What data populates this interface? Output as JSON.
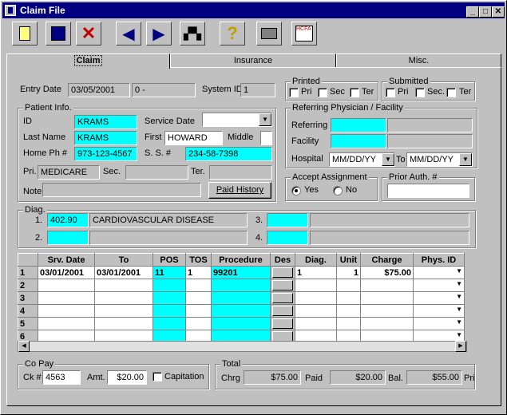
{
  "window": {
    "title": "Claim File"
  },
  "tabs": [
    "Claim",
    "Insurance",
    "Misc."
  ],
  "header": {
    "entry_date_label": "Entry Date",
    "entry_date": "03/05/2001",
    "entry_suffix": "0 -",
    "system_id_label": "System ID",
    "system_id": "1"
  },
  "printed": {
    "title": "Printed",
    "pri": "Pri",
    "sec": "Sec",
    "ter": "Ter"
  },
  "submitted": {
    "title": "Submitted",
    "pri": "Pri",
    "sec": "Sec.",
    "ter": "Ter"
  },
  "patient": {
    "title": "Patient Info.",
    "id_label": "ID",
    "id": "KRAMS",
    "last_label": "Last Name",
    "last": "KRAMS",
    "home_label": "Home Ph #",
    "home": "973-123-4567",
    "service_date_label": "Service Date",
    "service_date": "",
    "first_label": "First",
    "first": "HOWARD",
    "middle_label": "Middle",
    "middle": "",
    "ss_label": "S. S. #",
    "ss": "234-58-7398",
    "pri_label": "Pri.",
    "pri": "MEDICARE",
    "sec_label": "Sec.",
    "sec": "",
    "ter_label": "Ter.",
    "ter": "",
    "note_label": "Note",
    "note": "",
    "paid_history": "Paid History"
  },
  "referring": {
    "title": "Referring Physician / Facility",
    "referring_label": "Referring",
    "facility_label": "Facility",
    "hospital_label": "Hospital",
    "from_placeholder": "MM/DD/YY",
    "to_label": "To",
    "to_placeholder": "MM/DD/YY"
  },
  "accept": {
    "title": "Accept Assignment",
    "yes": "Yes",
    "no": "No",
    "selected": "Yes"
  },
  "prior_auth": {
    "title": "Prior Auth. #",
    "value": ""
  },
  "diag": {
    "title": "Diag.",
    "items": [
      {
        "num": "1.",
        "code": "402.90",
        "desc": "CARDIOVASCULAR DISEASE"
      },
      {
        "num": "2.",
        "code": "",
        "desc": ""
      },
      {
        "num": "3.",
        "code": "",
        "desc": ""
      },
      {
        "num": "4.",
        "code": "",
        "desc": ""
      }
    ]
  },
  "grid": {
    "headers": [
      "Srv. Date",
      "To",
      "POS",
      "TOS",
      "Procedure",
      "Des",
      "Diag.",
      "Unit",
      "Charge",
      "Phys. ID"
    ],
    "rows": [
      {
        "n": "1",
        "srv": "03/01/2001",
        "to": "03/01/2001",
        "pos": "11",
        "tos": "1",
        "proc": "99201",
        "diag": "1",
        "unit": "1",
        "charge": "$75.00",
        "phys": ""
      },
      {
        "n": "2",
        "srv": "",
        "to": "",
        "pos": "",
        "tos": "",
        "proc": "",
        "diag": "",
        "unit": "",
        "charge": "",
        "phys": ""
      },
      {
        "n": "3",
        "srv": "",
        "to": "",
        "pos": "",
        "tos": "",
        "proc": "",
        "diag": "",
        "unit": "",
        "charge": "",
        "phys": ""
      },
      {
        "n": "4",
        "srv": "",
        "to": "",
        "pos": "",
        "tos": "",
        "proc": "",
        "diag": "",
        "unit": "",
        "charge": "",
        "phys": ""
      },
      {
        "n": "5",
        "srv": "",
        "to": "",
        "pos": "",
        "tos": "",
        "proc": "",
        "diag": "",
        "unit": "",
        "charge": "",
        "phys": ""
      },
      {
        "n": "6",
        "srv": "",
        "to": "",
        "pos": "",
        "tos": "",
        "proc": "",
        "diag": "",
        "unit": "",
        "charge": "",
        "phys": ""
      }
    ]
  },
  "copay": {
    "title": "Co Pay",
    "ck_label": "Ck #",
    "ck": "4563",
    "amt_label": "Amt.",
    "amt": "$20.00",
    "capitation": "Capitation"
  },
  "total": {
    "title": "Total",
    "chrg_label": "Chrg",
    "chrg": "$75.00",
    "paid_label": "Paid",
    "paid": "$20.00",
    "bal_label": "Bal.",
    "bal": "$55.00",
    "pri_label": "Pri"
  },
  "colors": {
    "title_bar": "#000080",
    "field_highlight": "#00ffff",
    "face": "#c0c0c0"
  },
  "icons": [
    "new-document-icon",
    "save-icon",
    "delete-icon",
    "back-arrow-icon",
    "forward-arrow-icon",
    "binoculars-icon",
    "help-icon",
    "print-icon",
    "hcfa-form-icon"
  ]
}
